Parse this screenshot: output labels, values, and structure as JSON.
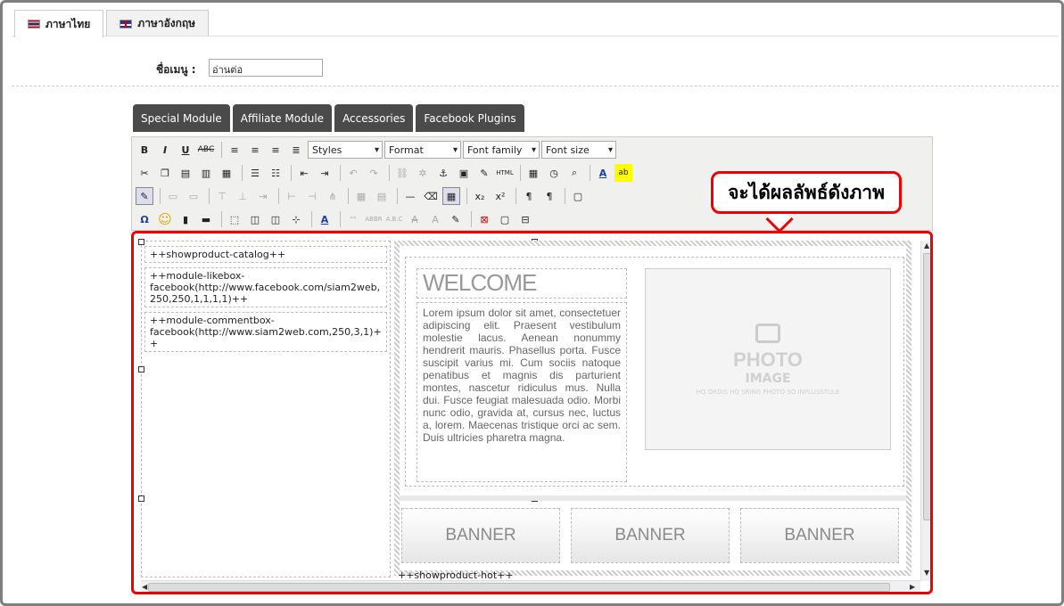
{
  "tabs": [
    {
      "label": "ภาษาไทย",
      "flag": "thai-flag-icon"
    },
    {
      "label": "ภาษาอังกฤษ",
      "flag": "uk-flag-icon"
    }
  ],
  "form": {
    "menu_label": "ชื่อเมนู :",
    "menu_value": "อ่านต่อ"
  },
  "module_buttons": [
    "Special Module",
    "Affiliate Module",
    "Accessories",
    "Facebook Plugins"
  ],
  "toolbar": {
    "styles": "Styles",
    "format": "Format",
    "font_family": "Font family",
    "font_size": "Font size"
  },
  "callout": "จะได้ผลลัพธ์ดังภาพ",
  "editor": {
    "left_tags": [
      "++showproduct-catalog++",
      "++module-likebox-facebook(http://www.facebook.com/siam2web,250,250,1,1,1,1)++",
      "++module-commentbox-facebook(http://www.siam2web.com,250,3,1)++"
    ],
    "welcome": "WELCOME",
    "lorem": "Lorem ipsum dolor sit amet, consectetuer adipiscing elit. Praesent vestibulum molestie lacus. Aenean nonummy hendrerit mauris. Phasellus porta. Fusce suscipit varius mi. Cum sociis natoque penatibus et magnis dis parturient montes, nascetur ridiculus mus. Nulla dui. Fusce feugiat malesuada odio. Morbi nunc odio, gravida at, cursus nec, luctus a, lorem. Maecenas tristique orci ac sem. Duis ultricies pharetra magna.",
    "photo_title": "PHOTO",
    "photo_sub": "IMAGE",
    "photo_note": "HQ ORDIS HQ SRING PHOTO SO INPLUSSTULE",
    "banners": [
      "BANNER",
      "BANNER",
      "BANNER"
    ],
    "hot_tag": "++showproduct-hot++"
  }
}
